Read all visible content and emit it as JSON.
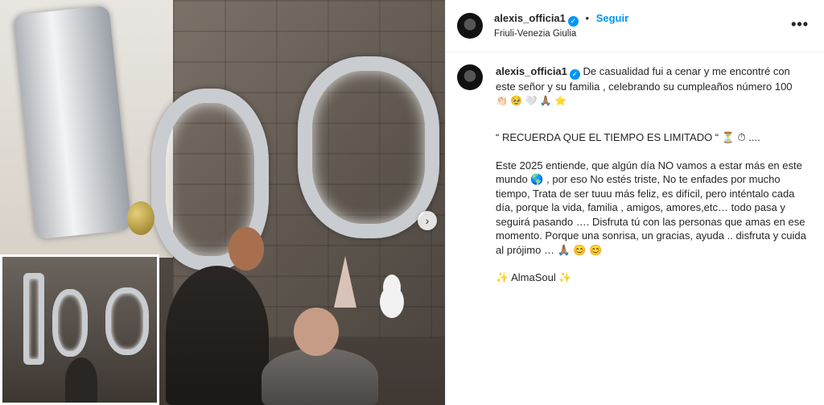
{
  "post": {
    "username": "alexis_officia1",
    "verified_mark": "✓",
    "follow_label": "Seguir",
    "location": "Friuli-Venezia Giulia",
    "more_label": "•••",
    "next_arrow": "›"
  },
  "caption": {
    "username": "alexis_officia1",
    "intro": "De casualidad fui a cenar y me encontré con este señor y su familia , celebrando su cumpleaños número 100",
    "intro_emojis": "👏🏻 🥹 🤍 🙏🏽 ⭐",
    "quote": "“ RECUERDA QUE EL TIEMPO ES LIMITADO “ ⏳ ⏱ ....",
    "paragraph": "Este 2025 entiende, que algún día NO vamos a estar más en este mundo 🌎 , por eso No estés triste, No te enfades por mucho tiempo, Trata de ser tuuu más feliz, es difícil, pero inténtalo cada día, porque la vida, familia , amigos, amores,etc… todo pasa y seguirá pasando …. Disfruta tú con las personas que amas en ese momento. Porque una sonrisa, un gracias, ayuda .. disfruta y cuida al prójimo … 🙏🏽 😊 😊",
    "signature": "✨ AlmaSoul ✨"
  },
  "colors": {
    "accent": "#0095f6",
    "text": "#262626",
    "border": "#efefef"
  }
}
